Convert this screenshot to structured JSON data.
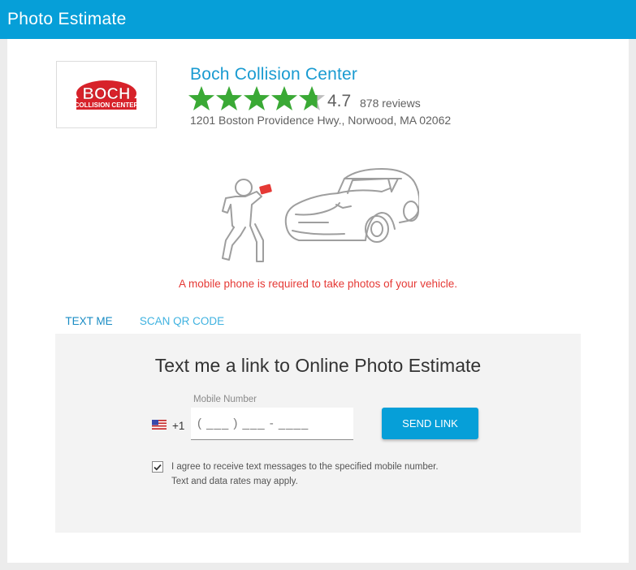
{
  "header": {
    "title": "Photo Estimate"
  },
  "logo": {
    "top_word": "BOCH",
    "bottom_words": "COLLISION CENTER"
  },
  "business": {
    "name": "Boch Collision Center",
    "rating": "4.7",
    "stars": 5,
    "reviews": "878 reviews",
    "address": "1201 Boston Providence Hwy., Norwood, MA 02062"
  },
  "notice": "A mobile phone is required to take photos of your vehicle.",
  "tabs": [
    {
      "label": "TEXT ME",
      "active": true
    },
    {
      "label": "SCAN QR CODE",
      "active": false
    }
  ],
  "panel": {
    "heading": "Text me a link to Online Photo Estimate",
    "mobile_label": "Mobile Number",
    "country_code": "+1",
    "phone_placeholder": "( ___ ) ___ - ____",
    "send_button": "SEND LINK",
    "consent_checked": true,
    "consent_line1": "I agree to receive text messages to the specified mobile number.",
    "consent_line2": "Text and data rates may apply."
  },
  "colors": {
    "brand_blue": "#069fd8",
    "star_green": "#3aa935",
    "notice_red": "#e53935",
    "logo_red": "#d7222a"
  },
  "icons": [
    "star-icon",
    "us-flag-icon",
    "checkmark-icon"
  ]
}
